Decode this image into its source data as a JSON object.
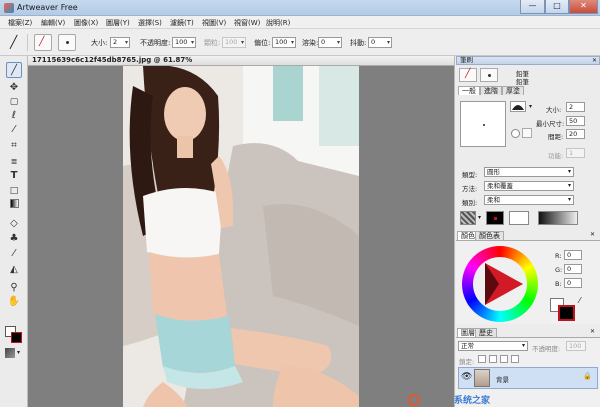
{
  "app": {
    "title": "Artweaver Free"
  },
  "window_buttons": {
    "minimize": "—",
    "maximize": "□",
    "close": "✕"
  },
  "menu": [
    "檔案(Z)",
    "編輯(V)",
    "圖像(X)",
    "圖層(Y)",
    "選擇(S)",
    "濾鏡(T)",
    "視圖(V)",
    "視窗(W)",
    "說明(R)"
  ],
  "options_bar": {
    "size_label": "大小:",
    "size_value": "2",
    "opacity_label": "不透明度:",
    "opacity_value": "100",
    "color_label": "顆粒:",
    "color_value": "100",
    "offset_label": "偏位:",
    "offset_value": "100",
    "mix_label": "溶染:",
    "mix_value": "0",
    "jitter_label": "抖動:",
    "jitter_value": "0"
  },
  "document": {
    "tab_title": "17115639c6c12f45db8765.jpg @ 61.87%"
  },
  "brush_panel": {
    "header": "筆刷",
    "brush_name": "鉛筆",
    "brush_sub": "鉛筆",
    "tabs": [
      "一般",
      "進階",
      "厚塗"
    ],
    "size_label": "大小:",
    "size_value": "2",
    "min_size_label": "最小尺寸:",
    "min_size_value": "50",
    "hardness_label": "間距:",
    "hardness_value": "20",
    "function_label": "功能:",
    "function_value": "1",
    "type_label": "類型:",
    "type_value": "圓形",
    "method_label": "方法:",
    "method_value": "柔和覆蓋",
    "category_label": "類別:",
    "category_value": "柔和"
  },
  "color_panel": {
    "tabs": [
      "顏色",
      "顏色表"
    ],
    "r_label": "R:",
    "r_value": "0",
    "g_label": "G:",
    "g_value": "0",
    "b_label": "B:",
    "b_value": "0",
    "accent": "#c1121c"
  },
  "layers_panel": {
    "tabs": [
      "圖層",
      "歷史"
    ],
    "blend_mode": "正常",
    "opacity_label": "不透明度:",
    "opacity_value": "100",
    "lock_label": "鎖定:",
    "layer_name": "背景"
  },
  "watermark": {
    "text": "系统之家"
  },
  "icons": [
    "pencil-icon",
    "move-icon",
    "rect-select-icon",
    "lasso-icon",
    "magic-wand-icon",
    "crop-icon",
    "gradient-icon",
    "text-icon",
    "shape-icon",
    "eraser-icon",
    "clone-icon",
    "eyedropper-icon",
    "fill-icon",
    "zoom-icon",
    "hand-icon",
    "eye-icon",
    "lock-icon"
  ]
}
